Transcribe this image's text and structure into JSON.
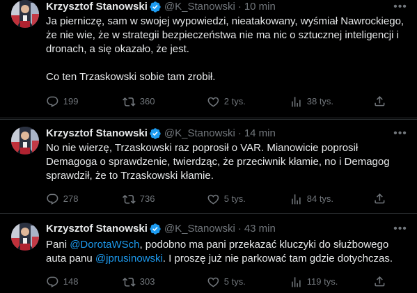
{
  "tweets": [
    {
      "name": "Krzysztof Stanowski",
      "handle": "@K_Stanowski",
      "separator": "·",
      "time": "10 min",
      "paragraphs": [
        "Ja pierniczę, sam w swojej wypowiedzi, nieatakowany, wyśmiał Nawrockiego, że nie wie, że w strategii bezpieczeństwa nie ma nic o sztucznej inteligencji i dronach, a się okazało, że jest.",
        "Co ten Trzaskowski sobie tam zrobił."
      ],
      "stats": {
        "replies": "199",
        "reposts": "360",
        "likes": "2 tys.",
        "views": "38 tys."
      }
    },
    {
      "name": "Krzysztof Stanowski",
      "handle": "@K_Stanowski",
      "separator": "·",
      "time": "14 min",
      "paragraphs": [
        "No nie wierzę, Trzaskowski raz poprosił o VAR. Mianowicie poprosił Demagoga o sprawdzenie, twierdząc, że przeciwnik kłamie, no i Demagog sprawdził, że to Trzaskowski kłamie."
      ],
      "stats": {
        "replies": "278",
        "reposts": "736",
        "likes": "5 tys.",
        "views": "84 tys."
      }
    },
    {
      "name": "Krzysztof Stanowski",
      "handle": "@K_Stanowski",
      "separator": "·",
      "time": "43 min",
      "text_parts": {
        "p1": "Pani ",
        "mention1": "@DorotaWSch",
        "p2": ", podobno ma pani przekazać kluczyki do służbowego auta panu ",
        "mention2": "@jprusinowski",
        "p3": ". I proszę już nie parkować tam gdzie dotychczas."
      },
      "stats": {
        "replies": "148",
        "reposts": "303",
        "likes": "5 tys.",
        "views": "119 tys."
      }
    }
  ],
  "icons": {
    "reply": "reply-icon",
    "repost": "repost-icon",
    "like": "heart-icon",
    "views": "views-icon",
    "share": "share-icon",
    "more": "more-icon",
    "verified": "verified-badge-icon"
  },
  "colors": {
    "background": "#000000",
    "text": "#e7e9ea",
    "muted": "#71767b",
    "accent": "#1d9bf0",
    "divider": "#2f3336"
  }
}
